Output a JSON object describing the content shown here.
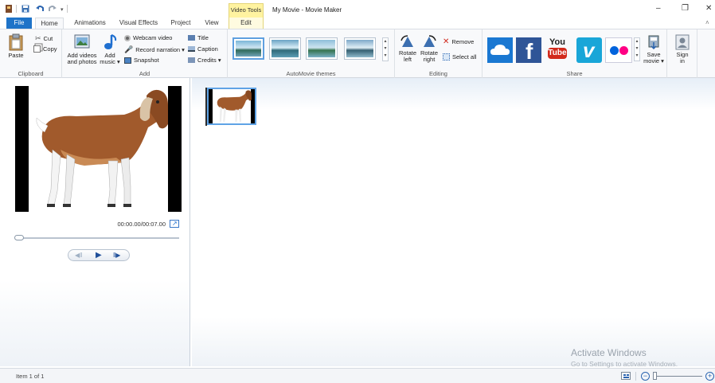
{
  "window": {
    "title": "My Movie - Movie Maker",
    "context_tab": "Video Tools",
    "context_subtab": "Edit",
    "controls": {
      "minimize": "–",
      "maximize": "❐",
      "close": "✕"
    }
  },
  "tabs": [
    "File",
    "Home",
    "Animations",
    "Visual Effects",
    "Project",
    "View"
  ],
  "ribbon": {
    "clipboard": {
      "paste": "Paste",
      "cut": "Cut",
      "copy": "Copy",
      "label": "Clipboard"
    },
    "add": {
      "add_videos_1": "Add videos",
      "add_videos_2": "and photos",
      "add_music_1": "Add",
      "add_music_2": "music ▾",
      "webcam": "Webcam video",
      "narration": "Record narration ▾",
      "snapshot": "Snapshot",
      "title": "Title",
      "caption": "Caption",
      "credits": "Credits ▾",
      "label": "Add"
    },
    "themes": {
      "label": "AutoMovie themes"
    },
    "editing": {
      "rotate_left_1": "Rotate",
      "rotate_left_2": "left",
      "rotate_right_1": "Rotate",
      "rotate_right_2": "right",
      "remove": "Remove",
      "select_all": "Select all",
      "label": "Editing"
    },
    "share": {
      "save_movie_1": "Save",
      "save_movie_2": "movie ▾",
      "sign_in_1": "Sign",
      "sign_in_2": "in",
      "label": "Share",
      "youtube_1": "You",
      "youtube_2": "Tube"
    }
  },
  "preview": {
    "time": "00:00.00/00:07.00",
    "progress": 0.0
  },
  "watermark": {
    "line1": "Activate Windows",
    "line2": "Go to Settings to activate Windows."
  },
  "status": {
    "item_count": "Item 1 of 1"
  },
  "colors": {
    "file_tab": "#1e73c8",
    "context_tab": "#fff3a0",
    "onedrive": "#1a78d2",
    "facebook": "#2f5597",
    "youtube": "#d22a1c",
    "vimeo": "#19a6d8",
    "flickr_blue": "#0063dc",
    "flickr_pink": "#ff0084"
  }
}
